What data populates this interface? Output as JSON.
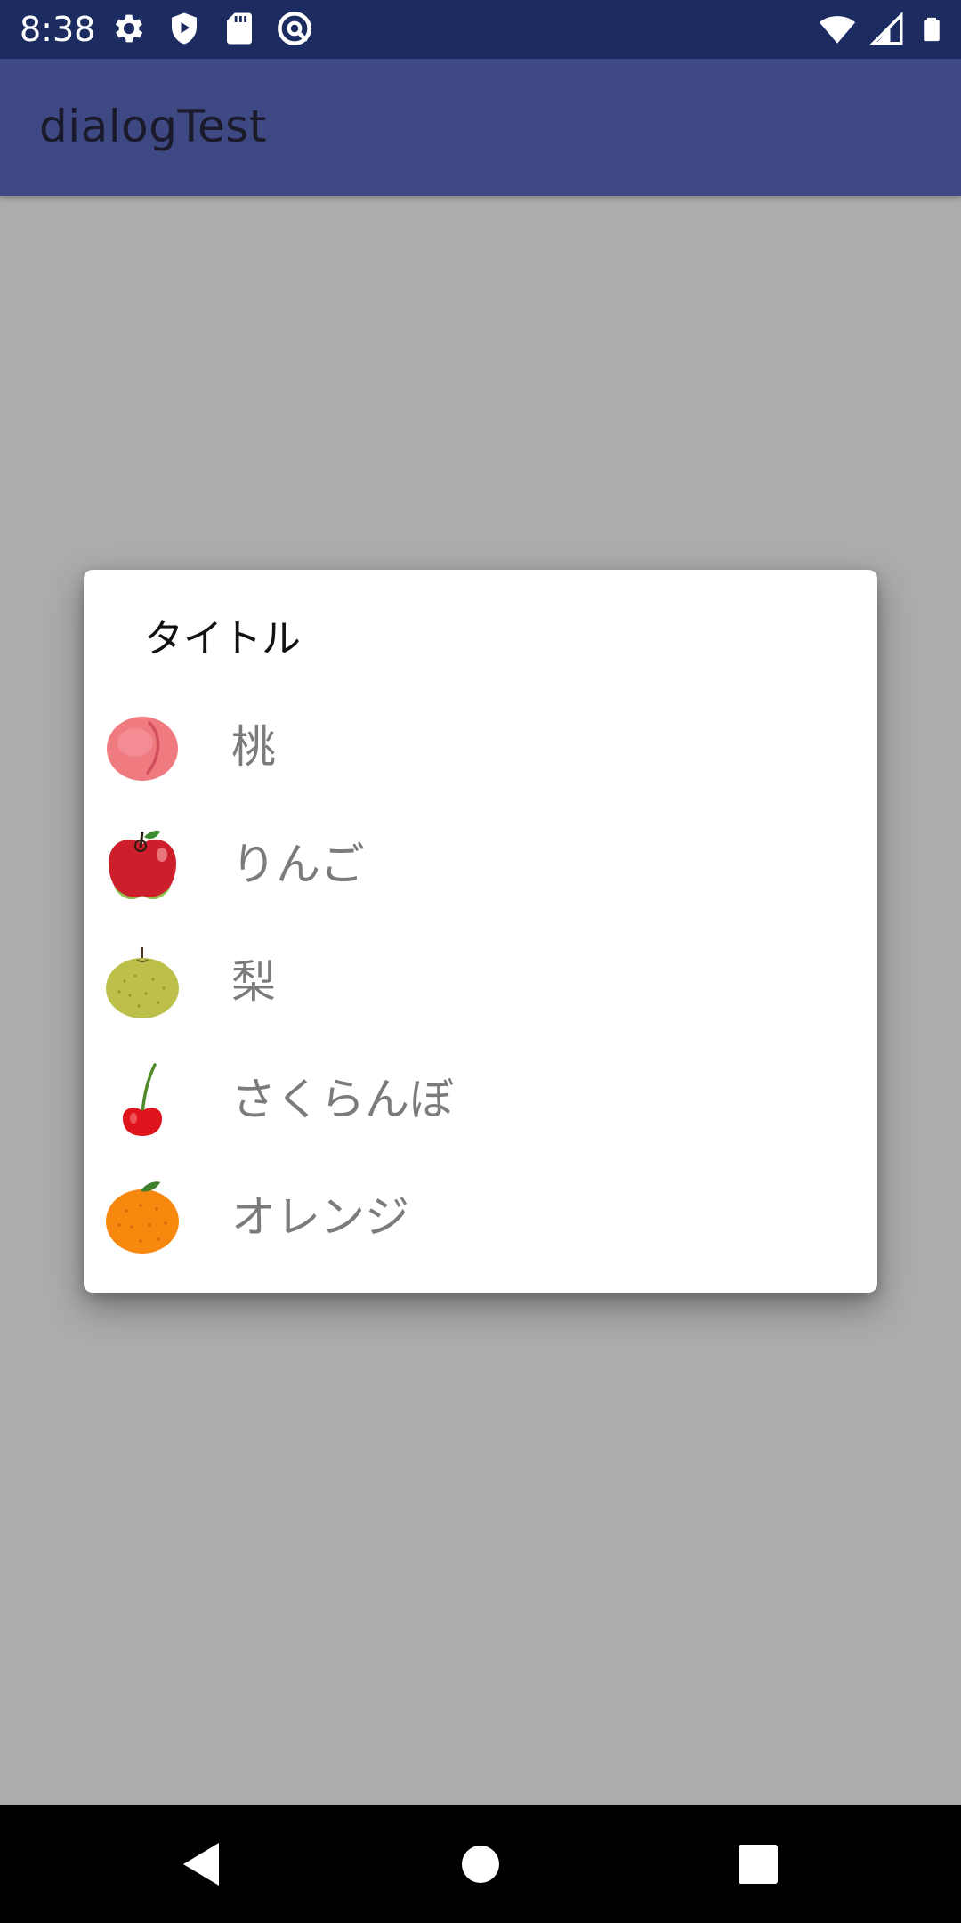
{
  "status_bar": {
    "time": "8:38",
    "left_icons": [
      "settings-gear-icon",
      "shield-play-icon",
      "sd-card-icon",
      "at-sign-icon"
    ],
    "right_icons": [
      "wifi-icon",
      "cellular-signal-icon",
      "battery-icon"
    ]
  },
  "app_bar": {
    "title": "dialogTest"
  },
  "dialog": {
    "title": "タイトル",
    "items": [
      {
        "label": "桃",
        "icon": "peach-icon"
      },
      {
        "label": "りんご",
        "icon": "apple-icon"
      },
      {
        "label": "梨",
        "icon": "pear-icon"
      },
      {
        "label": "さくらんぼ",
        "icon": "cherry-icon"
      },
      {
        "label": "オレンジ",
        "icon": "orange-icon"
      }
    ]
  },
  "nav_bar": {
    "buttons": [
      "back-icon",
      "home-icon",
      "recents-icon"
    ]
  },
  "colors": {
    "status_bar": "#1c2b60",
    "app_bar": "#3e4882",
    "scrim": "#acacac",
    "dialog_bg": "#ffffff",
    "item_text": "#7b7b7b"
  }
}
